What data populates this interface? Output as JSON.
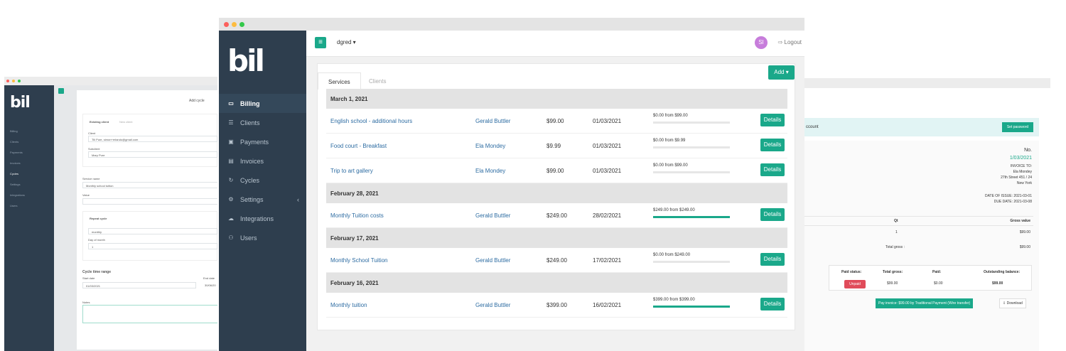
{
  "left_window": {
    "logo": "bil",
    "nav": [
      "Billing",
      "Clients",
      "Payments",
      "Invoices",
      "Cycles",
      "Settings",
      "Integrations",
      "Users"
    ],
    "modal_title": "Add cycle",
    "tabs": [
      "Existing client",
      "New client"
    ],
    "client_label": "Client",
    "client_value": "Tili Pure, simon+erlando@gmail.com",
    "subclient_label": "Subclient",
    "subclient_value": "Mary Pure",
    "service_label": "Service name",
    "service_value": "Monthly school tuition",
    "value_label": "Value",
    "repeat_tab": "Repeat cycle",
    "repeat_value": "monthly",
    "day_label": "Day of month",
    "day_value": "1",
    "range_title": "Cycle time range",
    "start_label": "Start date",
    "start_value": "01/03/2021",
    "end_label": "End date",
    "end_value": "30/06/20",
    "notes_label": "Notes"
  },
  "right_window": {
    "account_text": "ccount",
    "set_password": "Set password",
    "no_label": "No.",
    "no_value": "1/03/2021",
    "invoice_to_label": "INVOICE TO:",
    "invoice_to_name": "Ela Mondey",
    "invoice_to_address": "27th Street 451 / 24",
    "invoice_to_city": "New York",
    "date_issue": "DATE OF ISSUE: 2021-03-01",
    "due_date": "DUE DATE: 2021-03-08",
    "col_qt": "Qt",
    "col_gross": "Gross value",
    "qt_value": "1",
    "gross_value": "$99.00",
    "total_gross_label": "Total gross :",
    "total_gross_value": "$99.00",
    "paid_status_label": "Paid status:",
    "total_gross2_label": "Total gross:",
    "paid_label": "Paid:",
    "outstanding_label": "Outstanding balance:",
    "unpaid_badge": "Unpaid",
    "total_gross2_value": "$99.00",
    "paid_value": "$0.00",
    "outstanding_value": "$99.00",
    "pay_button": "Pay invoice: $99.00 by Traditional Payment (Wire transfer)",
    "download_button": "Download"
  },
  "main": {
    "logo": "bil",
    "nav": [
      {
        "label": "Billing",
        "icon": "billing-icon",
        "active": true
      },
      {
        "label": "Clients",
        "icon": "list-icon"
      },
      {
        "label": "Payments",
        "icon": "money-icon"
      },
      {
        "label": "Invoices",
        "icon": "file-icon"
      },
      {
        "label": "Cycles",
        "icon": "cycle-icon"
      },
      {
        "label": "Settings",
        "icon": "gears-icon"
      },
      {
        "label": "Integrations",
        "icon": "cloud-icon"
      },
      {
        "label": "Users",
        "icon": "users-icon"
      }
    ],
    "menu_button": "≡",
    "user_menu": "dgred ▾",
    "avatar": "SI",
    "logout": "Logout",
    "tabs": [
      "Services",
      "Clients"
    ],
    "add_button": "Add ▾",
    "details_label": "Details",
    "groups": [
      {
        "date": "March 1, 2021",
        "rows": [
          {
            "service": "English school - additional hours",
            "client": "Gerald Buttler",
            "amount": "$99.00",
            "date": "01/03/2021",
            "paid": "$0.00 from $99.00",
            "progress": 0
          },
          {
            "service": "Food court - Breakfast",
            "client": "Ela Mondey",
            "amount": "$9.99",
            "date": "01/03/2021",
            "paid": "$0.00 from $9.99",
            "progress": 0
          },
          {
            "service": "Trip to art gallery",
            "client": "Ela Mondey",
            "amount": "$99.00",
            "date": "01/03/2021",
            "paid": "$0.00 from $99.00",
            "progress": 0
          }
        ]
      },
      {
        "date": "February 28, 2021",
        "rows": [
          {
            "service": "Monthly Tuition costs",
            "client": "Gerald Buttler",
            "amount": "$249.00",
            "date": "28/02/2021",
            "paid": "$249.00 from $249.00",
            "progress": 1
          }
        ]
      },
      {
        "date": "February 17, 2021",
        "rows": [
          {
            "service": "Monthly School Tuition",
            "client": "Gerald Buttler",
            "amount": "$249.00",
            "date": "17/02/2021",
            "paid": "$0.00 from $249.00",
            "progress": 0
          }
        ]
      },
      {
        "date": "February 16, 2021",
        "rows": [
          {
            "service": "Monthly tuition",
            "client": "Gerald Buttler",
            "amount": "$399.00",
            "date": "16/02/2021",
            "paid": "$399.00 from $399.00",
            "progress": 1
          }
        ]
      }
    ]
  },
  "colors": {
    "accent": "#1aa88a",
    "sidebar": "#2e3e4e",
    "link": "#2d6ca2",
    "danger": "#e04b5a",
    "avatar": "#c77ddb"
  }
}
